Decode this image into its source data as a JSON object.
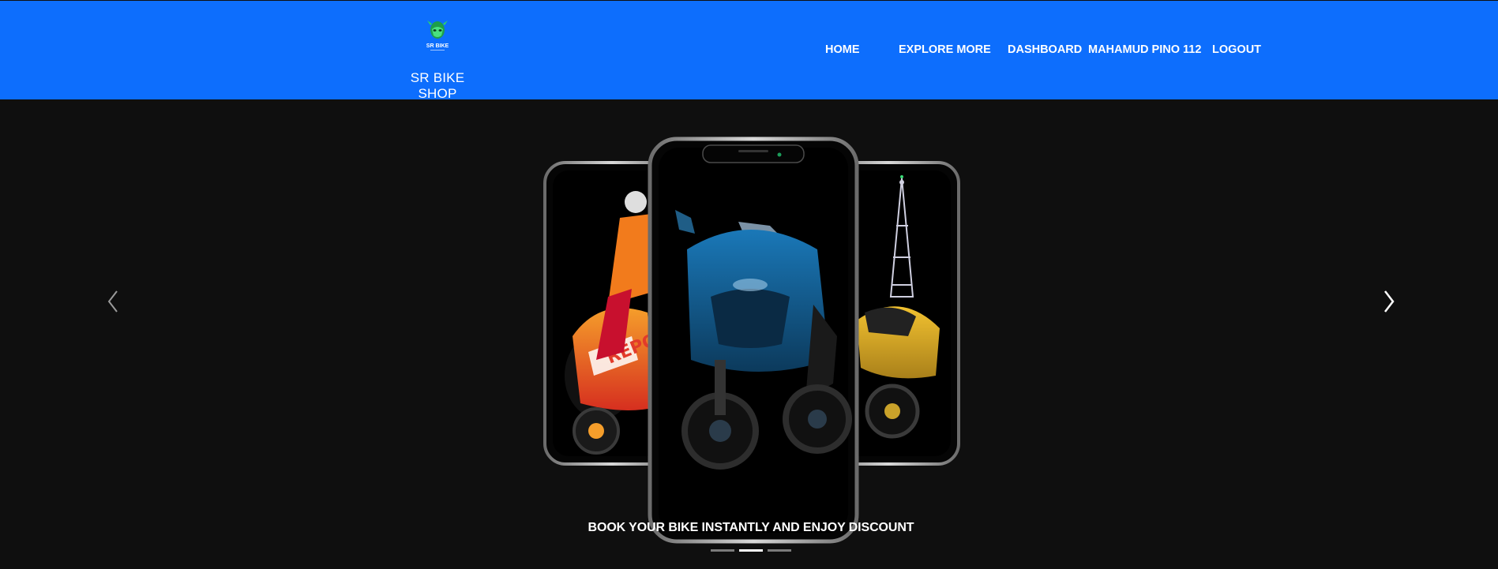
{
  "brand": {
    "logo_text": "SR BIKE",
    "name": "SR BIKE SHOP"
  },
  "nav": {
    "home": "HOME",
    "explore": "EXPLORE MORE",
    "dashboard": "DASHBOARD",
    "user": "MAHAMUD PINO 112",
    "logout": "LOGOUT"
  },
  "carousel": {
    "caption": "BOOK YOUR BIKE INSTANTLY AND ENJOY DISCOUNT",
    "prev_icon": "chevron-left-icon",
    "next_icon": "chevron-right-icon",
    "slide_count": 3,
    "active_slide": 2
  },
  "colors": {
    "navbar": "#0d6efd",
    "hero_background": "#0f0f0f",
    "logo_green": "#22c55e"
  }
}
